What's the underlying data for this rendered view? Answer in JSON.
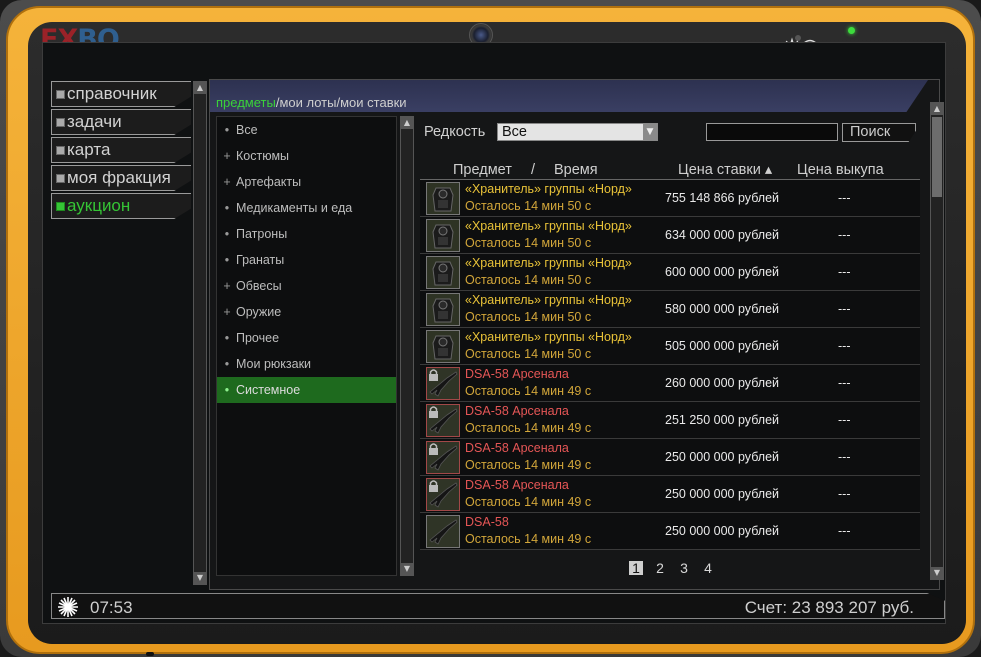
{
  "logo": {
    "part1": "EX",
    "part2": "BO"
  },
  "nav": {
    "items": [
      {
        "label": "справочник",
        "active": false
      },
      {
        "label": "задачи",
        "active": false
      },
      {
        "label": "карта",
        "active": false
      },
      {
        "label": "моя фракция",
        "active": false
      },
      {
        "label": "аукцион",
        "active": true
      }
    ]
  },
  "tabs": {
    "items": [
      "предметы",
      "мои лоты",
      "мои ставки"
    ],
    "separator": " / ",
    "active_index": 0
  },
  "categories": [
    {
      "marker": "•",
      "label": "Все",
      "active": false
    },
    {
      "marker": "+",
      "label": "Костюмы",
      "active": false
    },
    {
      "marker": "+",
      "label": "Артефакты",
      "active": false
    },
    {
      "marker": "•",
      "label": "Медикаменты и еда",
      "active": false
    },
    {
      "marker": "•",
      "label": "Патроны",
      "active": false
    },
    {
      "marker": "•",
      "label": "Гранаты",
      "active": false
    },
    {
      "marker": "+",
      "label": "Обвесы",
      "active": false
    },
    {
      "marker": "+",
      "label": "Оружие",
      "active": false
    },
    {
      "marker": "•",
      "label": "Прочее",
      "active": false
    },
    {
      "marker": "•",
      "label": "Мои рюкзаки",
      "active": false
    },
    {
      "marker": "•",
      "label": "Системное",
      "active": true
    }
  ],
  "filter": {
    "rarity_label": "Редкость",
    "rarity_value": "Все",
    "search_value": "",
    "search_button": "Поиск"
  },
  "table": {
    "headers": {
      "item": "Предмет",
      "sep": "/",
      "time": "Время",
      "bid": "Цена ставки ▴",
      "buyout": "Цена выкупа"
    },
    "rows": [
      {
        "name": "«Хранитель» группы «Норд»",
        "name_color": "yellow",
        "time": "Осталось 14 мин 50 с",
        "bid": "755 148 866 рублей",
        "buyout": "---",
        "thumb": "armor",
        "locked": false
      },
      {
        "name": "«Хранитель» группы «Норд»",
        "name_color": "yellow",
        "time": "Осталось 14 мин 50 с",
        "bid": "634 000 000 рублей",
        "buyout": "---",
        "thumb": "armor",
        "locked": false
      },
      {
        "name": "«Хранитель» группы «Норд»",
        "name_color": "yellow",
        "time": "Осталось 14 мин 50 с",
        "bid": "600 000 000 рублей",
        "buyout": "---",
        "thumb": "armor",
        "locked": false
      },
      {
        "name": "«Хранитель» группы «Норд»",
        "name_color": "yellow",
        "time": "Осталось 14 мин 50 с",
        "bid": "580 000 000 рублей",
        "buyout": "---",
        "thumb": "armor",
        "locked": false
      },
      {
        "name": "«Хранитель» группы «Норд»",
        "name_color": "yellow",
        "time": "Осталось 14 мин 50 с",
        "bid": "505 000 000 рублей",
        "buyout": "---",
        "thumb": "armor",
        "locked": false
      },
      {
        "name": "DSA-58 Арсенала",
        "name_color": "red",
        "time": "Осталось 14 мин 49 с",
        "bid": "260 000 000 рублей",
        "buyout": "---",
        "thumb": "rifle",
        "locked": true
      },
      {
        "name": "DSA-58 Арсенала",
        "name_color": "red",
        "time": "Осталось 14 мин 49 с",
        "bid": "251 250 000 рублей",
        "buyout": "---",
        "thumb": "rifle",
        "locked": true
      },
      {
        "name": "DSA-58 Арсенала",
        "name_color": "red",
        "time": "Осталось 14 мин 49 с",
        "bid": "250 000 000 рублей",
        "buyout": "---",
        "thumb": "rifle",
        "locked": true
      },
      {
        "name": "DSA-58 Арсенала",
        "name_color": "red",
        "time": "Осталось 14 мин 49 с",
        "bid": "250 000 000 рублей",
        "buyout": "---",
        "thumb": "rifle",
        "locked": true
      },
      {
        "name": "DSA-58",
        "name_color": "red",
        "time": "Осталось 14 мин 49 с",
        "bid": "250 000 000 рублей",
        "buyout": "---",
        "thumb": "rifle",
        "locked": false
      }
    ]
  },
  "pager": {
    "pages": [
      "1",
      "2",
      "3",
      "4"
    ],
    "current": "1"
  },
  "status": {
    "time": "07:53",
    "balance": "Счет: 23 893 207 руб."
  },
  "colors": {
    "active_green": "#35c535",
    "item_yellow": "#e8c238",
    "item_red": "#e55656",
    "time_orange": "#d2a63a",
    "shell_orange": "#f5b33a",
    "tab_bar": "#3a3f63"
  },
  "icons": {
    "clock": "sunburst-clock-icon",
    "signal": "wifi-signal-icon",
    "battery": "battery-icon",
    "lock": "lock-icon"
  }
}
